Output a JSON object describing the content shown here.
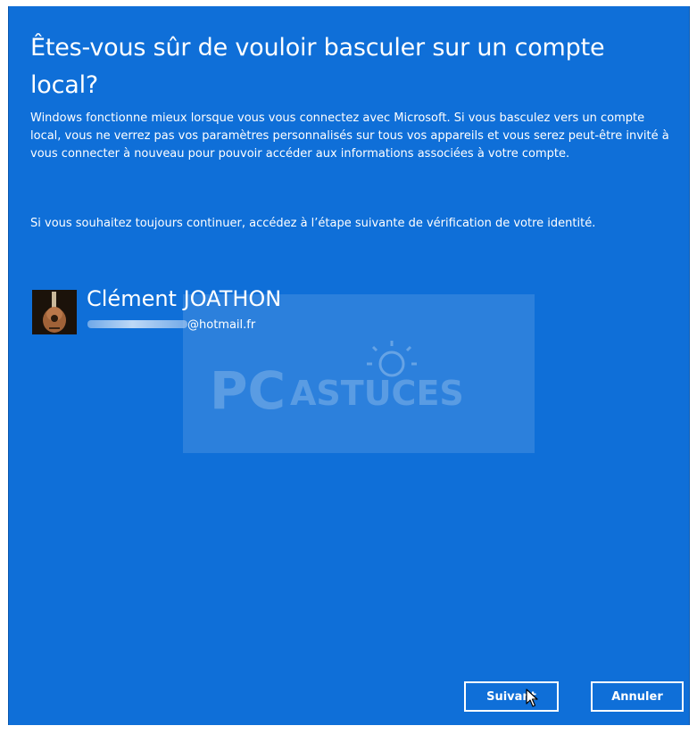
{
  "dialog": {
    "title": "Êtes-vous sûr de vouloir basculer sur un compte local?",
    "paragraph1": "Windows fonctionne mieux lorsque vous vous connectez avec Microsoft. Si vous basculez vers un compte local, vous ne verrez pas vos paramètres personnalisés sur tous vos appareils et vous serez peut-être invité à vous connecter à nouveau pour pouvoir accéder aux informations associées à votre compte.",
    "paragraph2": "Si vous souhaitez toujours continuer, accédez à l’étape suivante de vérification de votre identité."
  },
  "account": {
    "name": "Clément JOATHON",
    "email_suffix": "@hotmail.fr",
    "avatar_icon": "guitar-avatar-icon"
  },
  "watermark": {
    "text_pc": "PC",
    "text_astuces": "ASTUCES"
  },
  "buttons": {
    "next_label": "Suivant",
    "cancel_label": "Annuler"
  },
  "colors": {
    "background": "#0f6fd8",
    "text": "#ffffff",
    "button_border": "#ffffff"
  }
}
